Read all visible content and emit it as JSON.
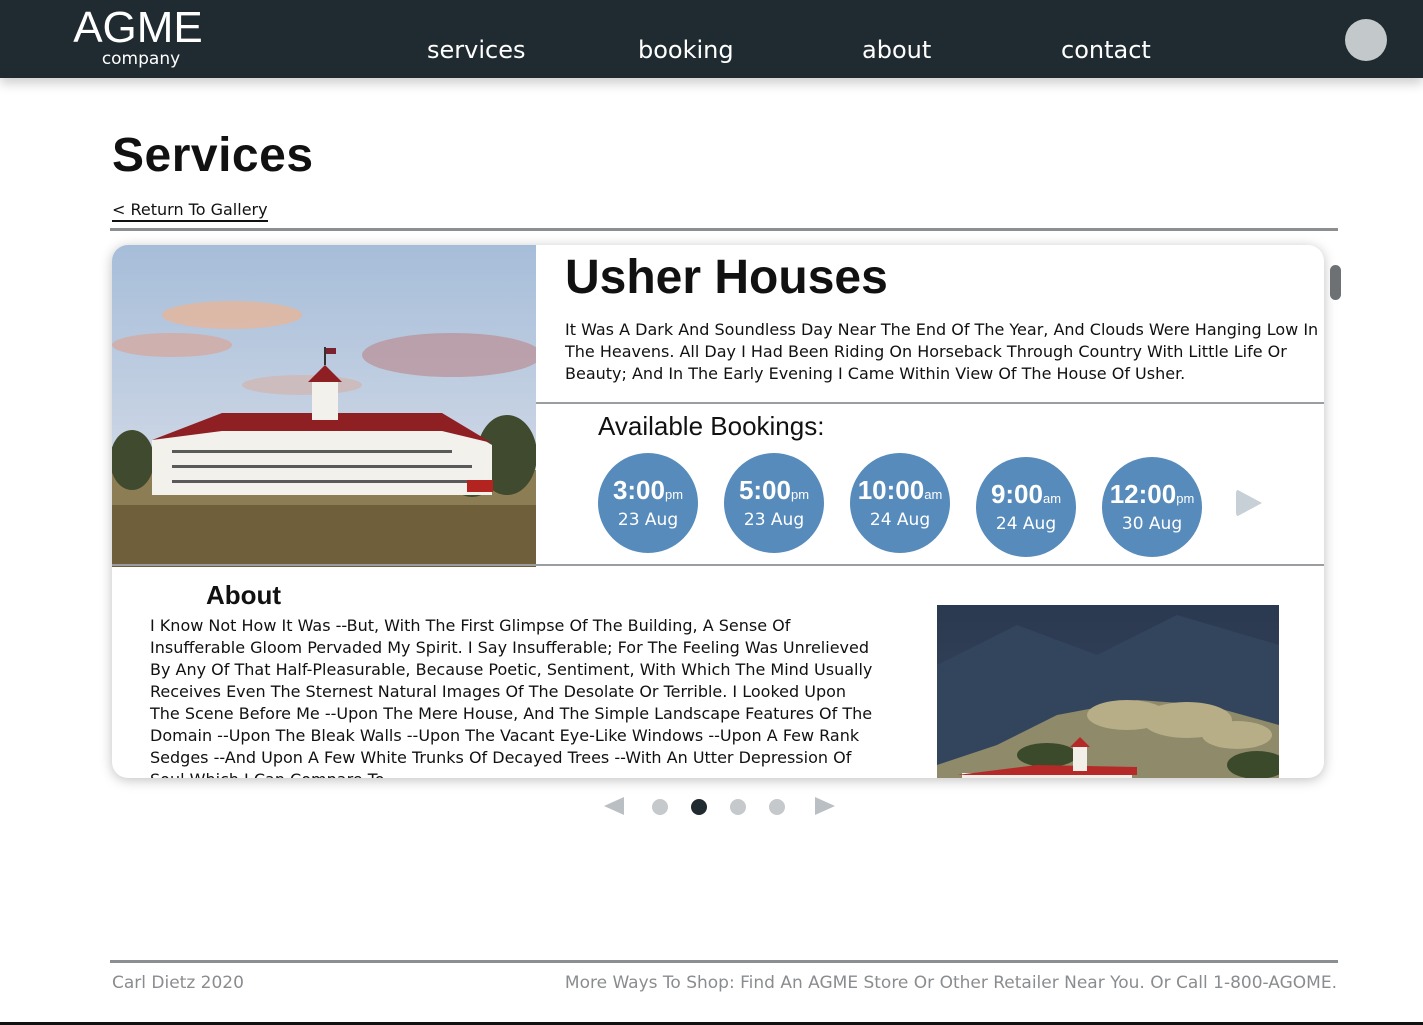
{
  "header": {
    "logo_main": "AGME",
    "logo_sub": "company",
    "nav": [
      "services",
      "booking",
      "about",
      "contact"
    ]
  },
  "page": {
    "title": "Services",
    "return_link": "< Return To Gallery"
  },
  "listing": {
    "title": "Usher Houses",
    "description": "It Was A Dark And Soundless Day Near The End Of The Year, And Clouds Were Hanging Low In The Heavens. All Day I Had Been Riding On Horseback Through Country With Little Life Or Beauty; And In The Early Evening I Came Within View Of The House Of Usher.",
    "bookings_label": "Available Bookings:",
    "slots": [
      {
        "time": "3:00",
        "ampm": "pm",
        "date": "23 Aug"
      },
      {
        "time": "5:00",
        "ampm": "pm",
        "date": "23 Aug"
      },
      {
        "time": "10:00",
        "ampm": "am",
        "date": "24 Aug"
      },
      {
        "time": "9:00",
        "ampm": "am",
        "date": "24 Aug"
      },
      {
        "time": "12:00",
        "ampm": "pm",
        "date": "30 Aug"
      }
    ],
    "about_heading": "About",
    "about_text": "I Know Not How It Was --But, With The First Glimpse Of The Building, A Sense Of Insufferable Gloom Pervaded My Spirit. I Say Insufferable; For The Feeling Was Unrelieved By Any Of That Half-Pleasurable, Because Poetic, Sentiment, With Which The Mind Usually Receives Even The Sternest Natural Images Of The Desolate Or Terrible. I Looked Upon The Scene Before Me --Upon The Mere House, And The Simple Landscape Features Of The Domain --Upon The Bleak Walls --Upon The Vacant Eye-Like Windows --Upon A Few Rank Sedges --And Upon A Few White Trunks Of Decayed Trees --With An Utter Depression Of Soul Which I Can Compare To"
  },
  "pager": {
    "count": 4,
    "active_index": 1
  },
  "footer": {
    "left": "Carl Dietz 2020",
    "right": "More Ways To Shop: Find An AGME Store Or Other Retailer Near You. Or Call 1-800-AGOME."
  },
  "colors": {
    "header_bg": "#202b31",
    "slot_bg": "#578bbb",
    "footer_text": "#8a8d90"
  }
}
